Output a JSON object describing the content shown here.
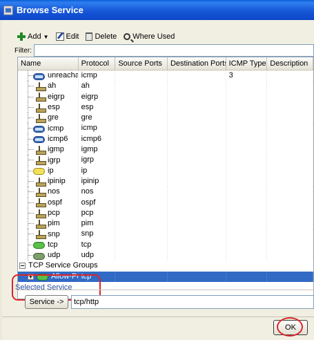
{
  "window": {
    "title": "Browse Service"
  },
  "toolbar": {
    "add_label": "Add",
    "edit_label": "Edit",
    "delete_label": "Delete",
    "where_used_label": "Where Used"
  },
  "filter": {
    "label": "Filter:",
    "value": ""
  },
  "table": {
    "columns": [
      "Name",
      "Protocol",
      "Source Ports",
      "Destination Ports",
      "ICMP Type",
      "Description"
    ],
    "rows": [
      {
        "name": "unreacha...",
        "protocol": "icmp",
        "icon": "icmp-icon",
        "icmp_type": "3"
      },
      {
        "name": "ah",
        "protocol": "ah",
        "icon": "protocol-icon"
      },
      {
        "name": "eigrp",
        "protocol": "eigrp",
        "icon": "protocol-icon"
      },
      {
        "name": "esp",
        "protocol": "esp",
        "icon": "protocol-icon"
      },
      {
        "name": "gre",
        "protocol": "gre",
        "icon": "protocol-icon"
      },
      {
        "name": "icmp",
        "protocol": "icmp",
        "icon": "icmp-icon"
      },
      {
        "name": "icmp6",
        "protocol": "icmp6",
        "icon": "icmp-icon"
      },
      {
        "name": "igmp",
        "protocol": "igmp",
        "icon": "protocol-icon"
      },
      {
        "name": "igrp",
        "protocol": "igrp",
        "icon": "protocol-icon"
      },
      {
        "name": "ip",
        "protocol": "ip",
        "icon": "ip-icon"
      },
      {
        "name": "ipinip",
        "protocol": "ipinip",
        "icon": "protocol-icon"
      },
      {
        "name": "nos",
        "protocol": "nos",
        "icon": "protocol-icon"
      },
      {
        "name": "ospf",
        "protocol": "ospf",
        "icon": "protocol-icon"
      },
      {
        "name": "pcp",
        "protocol": "pcp",
        "icon": "protocol-icon"
      },
      {
        "name": "pim",
        "protocol": "pim",
        "icon": "protocol-icon"
      },
      {
        "name": "snp",
        "protocol": "snp",
        "icon": "protocol-icon"
      },
      {
        "name": "tcp",
        "protocol": "tcp",
        "icon": "tcp-icon"
      },
      {
        "name": "udp",
        "protocol": "udp",
        "icon": "udp-icon"
      }
    ],
    "group": {
      "name": "TCP Service Groups",
      "expanded": true
    },
    "group_rows": [
      {
        "name": "Allow-Ports",
        "protocol": "tcp",
        "icon": "tcp-icon",
        "selected": true
      }
    ]
  },
  "selected_service": {
    "label": "Selected Service",
    "button_label": "Service ->",
    "value": "tcp/http"
  },
  "buttons": {
    "ok_label": "OK"
  },
  "colors": {
    "titlebar": "#0d47c8",
    "selection": "#316ac5",
    "highlight": "#d9262a"
  }
}
